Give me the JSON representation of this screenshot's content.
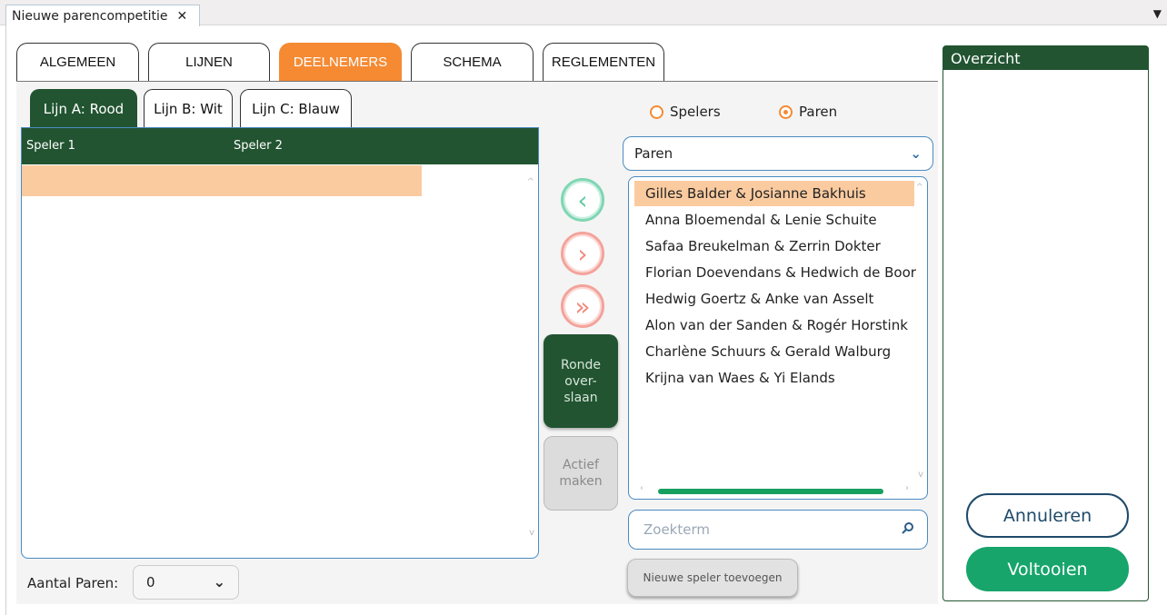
{
  "doc_tab": {
    "title": "Nieuwe parencompetitie",
    "close": "✕",
    "menu": "▼"
  },
  "tabs": [
    "ALGEMEEN",
    "LIJNEN",
    "DEELNEMERS",
    "SCHEMA",
    "REGLEMENTEN"
  ],
  "sub_tabs": [
    "Lijn A: Rood",
    "Lijn B: Wit",
    "Lijn C: Blauw"
  ],
  "table": {
    "col1": "Speler 1",
    "col2": "Speler 2"
  },
  "aantal": {
    "label": "Aantal Paren:",
    "value": "0"
  },
  "middle": {
    "back_glyph": "‹",
    "forward_glyph": "›",
    "forward_all_glyph": "»",
    "ronde_overslaan": "Ronde over- slaan",
    "actief_maken": "Actief maken"
  },
  "radios": {
    "spelers": "Spelers",
    "paren": "Paren",
    "selected": "paren"
  },
  "paren_select": {
    "value": "Paren"
  },
  "pairs": [
    "Gilles Balder & Josianne Bakhuis",
    "Anna Bloemendal & Lenie Schuite",
    "Safaa Breukelman & Zerrin Dokter",
    "Florian Doevendans & Hedwich de Boor",
    "Hedwig Goertz & Anke van  Asselt",
    "Alon van der Sanden & Rogér Horstink",
    "Charlène Schuurs & Gerald Walburg",
    "Krijna van Waes & Yi Elands"
  ],
  "search": {
    "placeholder": "Zoekterm"
  },
  "new_player_button": "Nieuwe speler toevoegen",
  "overview": {
    "title": "Overzicht"
  },
  "buttons": {
    "annuleren": "Annuleren",
    "voltooien": "Voltooien"
  },
  "colors": {
    "accent": "#f58a33",
    "dark_green": "#225431",
    "green": "#17a56b",
    "selection": "#fbcba0"
  }
}
